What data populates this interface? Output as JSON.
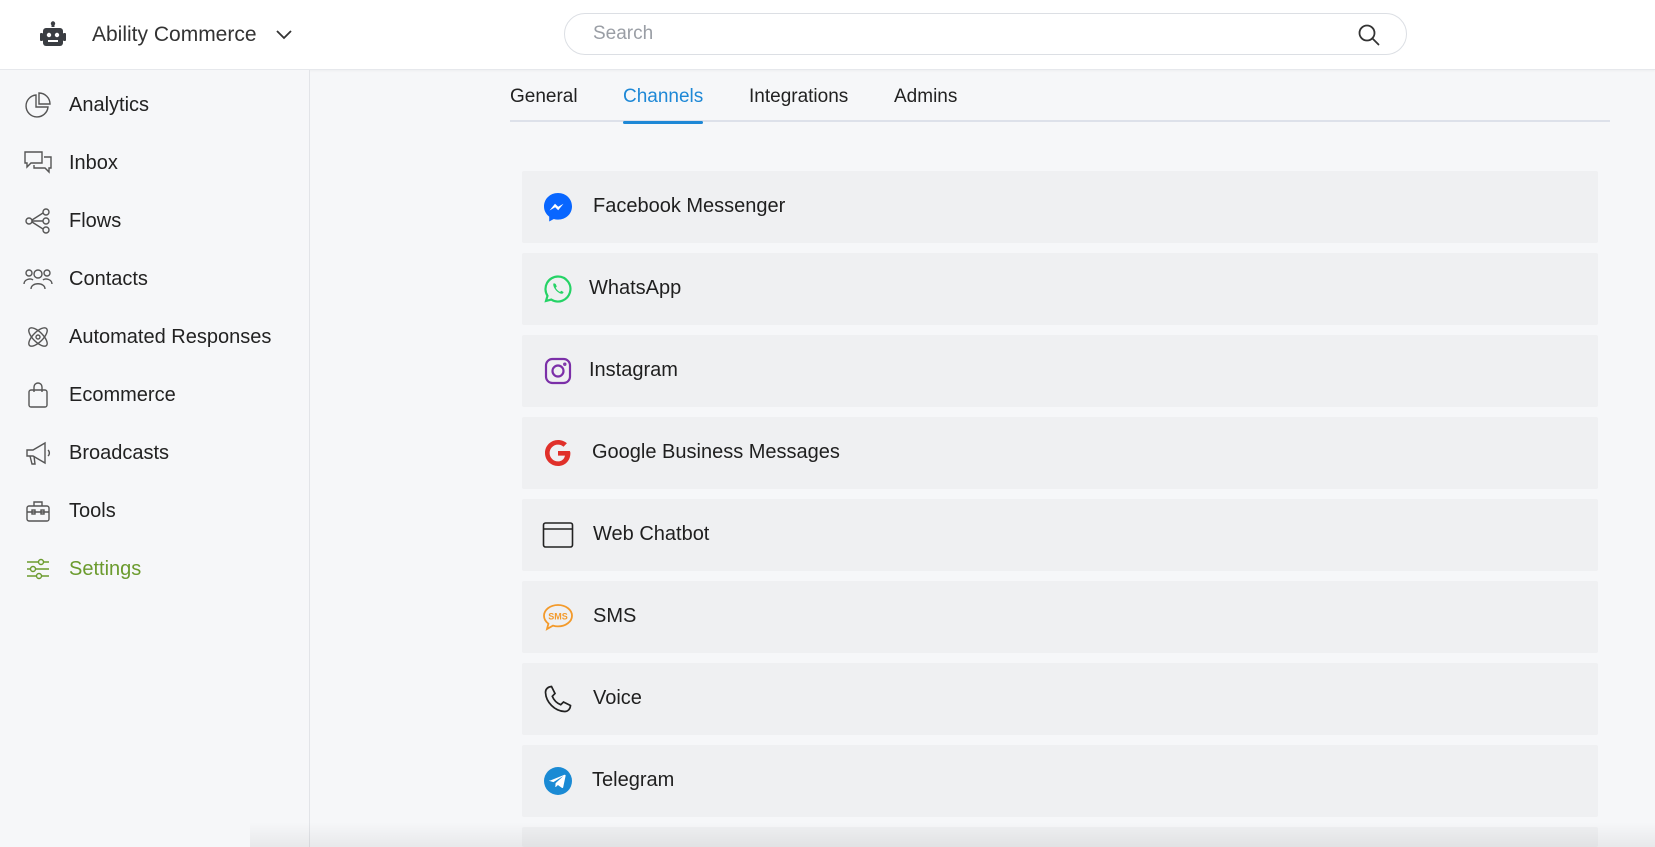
{
  "header": {
    "workspace_name": "Ability Commerce",
    "search_placeholder": "Search"
  },
  "sidebar": {
    "items": [
      {
        "label": "Analytics",
        "icon": "analytics-icon"
      },
      {
        "label": "Inbox",
        "icon": "inbox-icon"
      },
      {
        "label": "Flows",
        "icon": "flows-icon"
      },
      {
        "label": "Contacts",
        "icon": "contacts-icon"
      },
      {
        "label": "Automated Responses",
        "icon": "automated-responses-icon"
      },
      {
        "label": "Ecommerce",
        "icon": "shopping-bag-icon"
      },
      {
        "label": "Broadcasts",
        "icon": "megaphone-icon"
      },
      {
        "label": "Tools",
        "icon": "toolbox-icon"
      },
      {
        "label": "Settings",
        "icon": "sliders-icon",
        "active": true
      }
    ]
  },
  "tabs": [
    {
      "label": "General"
    },
    {
      "label": "Channels",
      "active": true
    },
    {
      "label": "Integrations"
    },
    {
      "label": "Admins"
    }
  ],
  "channels": [
    {
      "label": "Facebook Messenger",
      "icon": "messenger-icon"
    },
    {
      "label": "WhatsApp",
      "icon": "whatsapp-icon"
    },
    {
      "label": "Instagram",
      "icon": "instagram-icon"
    },
    {
      "label": "Google Business Messages",
      "icon": "google-icon"
    },
    {
      "label": "Web Chatbot",
      "icon": "browser-window-icon"
    },
    {
      "label": "SMS",
      "icon": "sms-icon"
    },
    {
      "label": "Voice",
      "icon": "phone-icon"
    },
    {
      "label": "Telegram",
      "icon": "telegram-icon"
    }
  ],
  "colors": {
    "active_tab": "#1e88d6",
    "active_nav": "#6b9b2e",
    "messenger": "#0866ff",
    "whatsapp": "#25d366",
    "instagram": "#7b2fa8",
    "google": "#e0302a",
    "sms": "#f39a2b",
    "telegram": "#1a8ad4"
  }
}
